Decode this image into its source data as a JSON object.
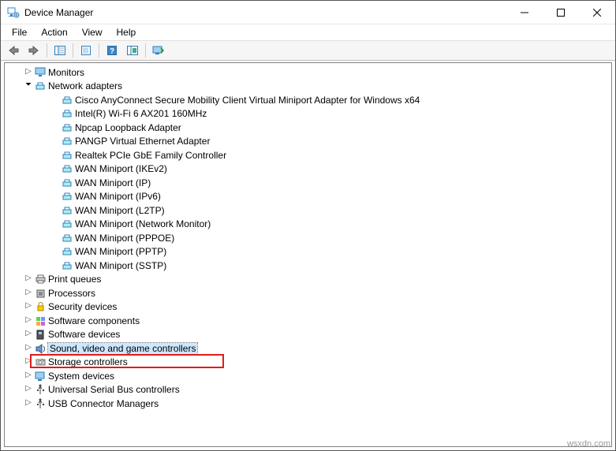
{
  "window": {
    "title": "Device Manager"
  },
  "menu": {
    "file": "File",
    "action": "Action",
    "view": "View",
    "help": "Help"
  },
  "tree": {
    "monitors": {
      "label": "Monitors"
    },
    "network": {
      "label": "Network adapters",
      "items": [
        "Cisco AnyConnect Secure Mobility Client Virtual Miniport Adapter for Windows x64",
        "Intel(R) Wi-Fi 6 AX201 160MHz",
        "Npcap Loopback Adapter",
        "PANGP Virtual Ethernet Adapter",
        "Realtek PCIe GbE Family Controller",
        "WAN Miniport (IKEv2)",
        "WAN Miniport (IP)",
        "WAN Miniport (IPv6)",
        "WAN Miniport (L2TP)",
        "WAN Miniport (Network Monitor)",
        "WAN Miniport (PPPOE)",
        "WAN Miniport (PPTP)",
        "WAN Miniport (SSTP)"
      ]
    },
    "print_queues": {
      "label": "Print queues"
    },
    "processors": {
      "label": "Processors"
    },
    "security_devices": {
      "label": "Security devices"
    },
    "software_components": {
      "label": "Software components"
    },
    "software_devices": {
      "label": "Software devices"
    },
    "sound": {
      "label": "Sound, video and game controllers"
    },
    "storage": {
      "label": "Storage controllers"
    },
    "system_devices": {
      "label": "System devices"
    },
    "usb_controllers": {
      "label": "Universal Serial Bus controllers"
    },
    "usb_conn_managers": {
      "label": "USB Connector Managers"
    }
  },
  "watermark": "wsxdn.com"
}
